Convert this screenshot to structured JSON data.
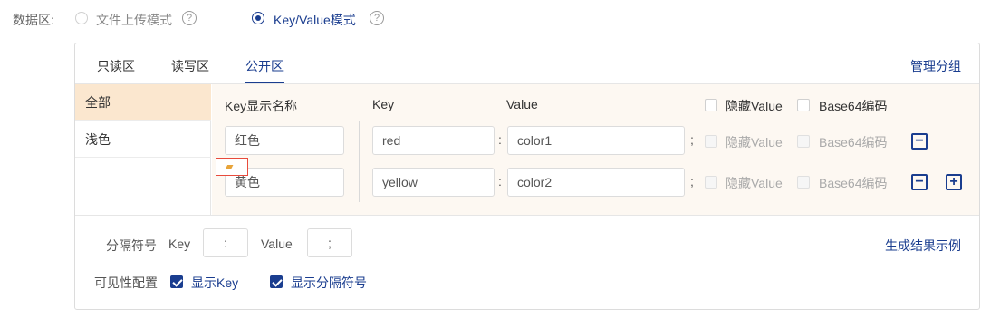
{
  "mode": {
    "label": "数据区:",
    "options": [
      {
        "label": "文件上传模式",
        "selected": false
      },
      {
        "label": "Key/Value模式",
        "selected": true
      }
    ],
    "help_icon": "question-circle-icon"
  },
  "tabs": [
    {
      "label": "只读区",
      "active": false
    },
    {
      "label": "读写区",
      "active": false
    },
    {
      "label": "公开区",
      "active": true
    }
  ],
  "manage_group": "管理分组",
  "sidebar": {
    "items": [
      {
        "label": "全部",
        "active": true
      },
      {
        "label": "浅色",
        "active": false
      }
    ]
  },
  "kv": {
    "headers": {
      "display_name": "Key显示名称",
      "key": "Key",
      "value": "Value",
      "hide_value": "隐藏Value",
      "base64": "Base64编码"
    },
    "rows": [
      {
        "display_name": "红色",
        "key": "red",
        "kv_sep": ":",
        "value": "color1",
        "row_sep": ";",
        "hide_value": "隐藏Value",
        "base64": "Base64编码"
      },
      {
        "display_name": "黄色",
        "key": "yellow",
        "kv_sep": ":",
        "value": "color2",
        "row_sep": ";",
        "hide_value": "隐藏Value",
        "base64": "Base64编码"
      }
    ]
  },
  "separator": {
    "label": "分隔符号",
    "key_label": "Key",
    "key_value": ":",
    "value_label": "Value",
    "value_value": ";",
    "generate_link": "生成结果示例"
  },
  "visibility": {
    "label": "可见性配置",
    "show_key": "显示Key",
    "show_separator": "显示分隔符号"
  },
  "colors": {
    "accent": "#1a3d8f",
    "sidebar_active": "#fbe7cf",
    "kv_background": "#fdf8f2"
  }
}
